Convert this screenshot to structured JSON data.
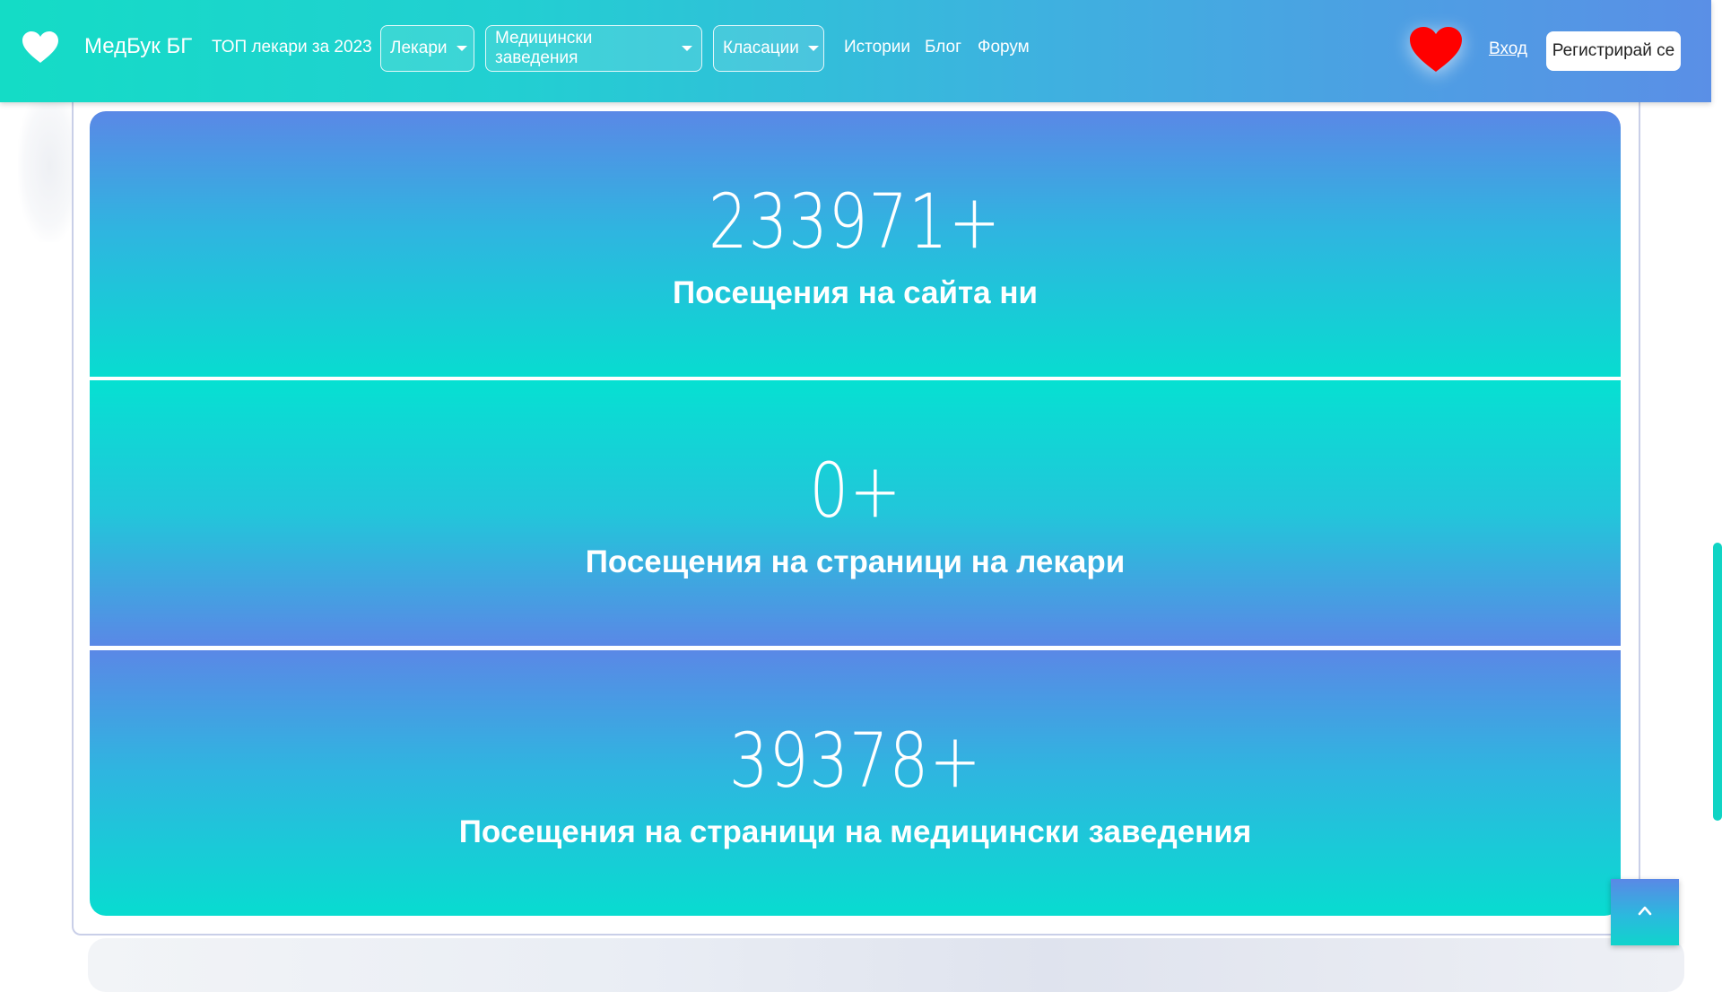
{
  "header": {
    "brand": "МедБук БГ",
    "brand_icon": "heart-icon",
    "top_doctors_link": "ТОП лекари за 2023",
    "dropdowns": [
      {
        "label": "Лекари"
      },
      {
        "label": "Медицински заведения"
      },
      {
        "label": "Класации"
      }
    ],
    "links": [
      "Истории",
      "Блог",
      "Форум"
    ],
    "favorites_icon": "heart-icon",
    "favorites_color": "#ff0000",
    "login": "Вход",
    "register": "Регистрирай се"
  },
  "stats": [
    {
      "value": "233971+",
      "label": "Посещения на сайта ни"
    },
    {
      "value": "0+",
      "label": "Посещения на страници на лекари"
    },
    {
      "value": "39378+",
      "label": "Посещения на страници на медицински заведения"
    }
  ],
  "colors": {
    "teal": "#06e0d2",
    "blue": "#5a88e6"
  },
  "back_to_top_icon": "chevron-up-icon"
}
